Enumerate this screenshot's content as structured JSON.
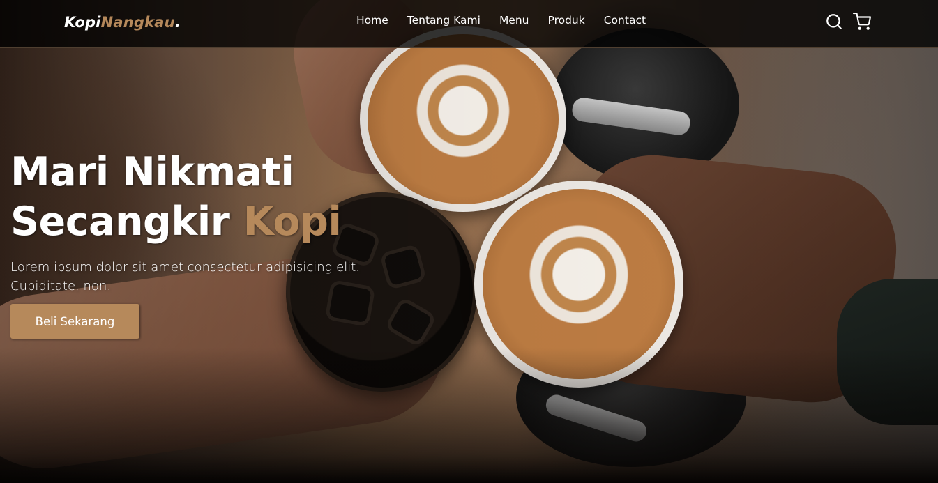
{
  "brand": {
    "logo_primary": "Kopi",
    "logo_accent": "Nangkau",
    "logo_dot": "."
  },
  "nav": {
    "links": [
      "Home",
      "Tentang Kami",
      "Menu",
      "Produk",
      "Contact"
    ],
    "icons": [
      "search-icon",
      "shopping-cart-icon"
    ]
  },
  "hero": {
    "headline_line1": "Mari Nikmati",
    "headline_line2_prefix": "Secangkir ",
    "headline_line2_accent": "Kopi",
    "subtitle": "Lorem ipsum dolor sit amet consectetur adipisicing elit. Cupiditate, non.",
    "cta_label": "Beli Sekarang"
  },
  "colors": {
    "accent": "#b6895b",
    "navbar_bg": "rgba(0,0,0,0.78)",
    "text": "#ffffff"
  }
}
